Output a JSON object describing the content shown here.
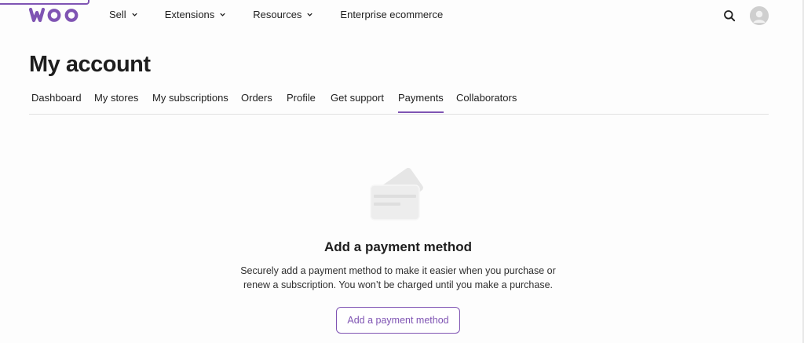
{
  "header": {
    "logo_text": "woo",
    "nav": [
      {
        "label": "Sell",
        "has_dropdown": true
      },
      {
        "label": "Extensions",
        "has_dropdown": true
      },
      {
        "label": "Resources",
        "has_dropdown": true
      },
      {
        "label": "Enterprise ecommerce",
        "has_dropdown": false
      }
    ],
    "icons": {
      "search": "search-icon",
      "avatar": "user-avatar"
    }
  },
  "page": {
    "title": "My account"
  },
  "tabs": [
    {
      "label": "Dashboard",
      "active": false
    },
    {
      "label": "My stores",
      "active": false
    },
    {
      "label": "My subscriptions",
      "active": false
    },
    {
      "label": "Orders",
      "active": false
    },
    {
      "label": "Profile",
      "active": false
    },
    {
      "label": "Get support",
      "active": false
    },
    {
      "label": "Payments",
      "active": true
    },
    {
      "label": "Collaborators",
      "active": false
    }
  ],
  "empty_state": {
    "icon": "credit-card-icon",
    "title": "Add a payment method",
    "description": "Securely add a payment method to make it easier when you purchase or renew a subscription. You won’t be charged until you make a purchase.",
    "button_label": "Add a payment method"
  },
  "colors": {
    "brand_purple": "#7f54b3",
    "text": "#1e1e1e",
    "divider": "#e2e2e2",
    "illustration_gray": "#e6e6e6"
  }
}
